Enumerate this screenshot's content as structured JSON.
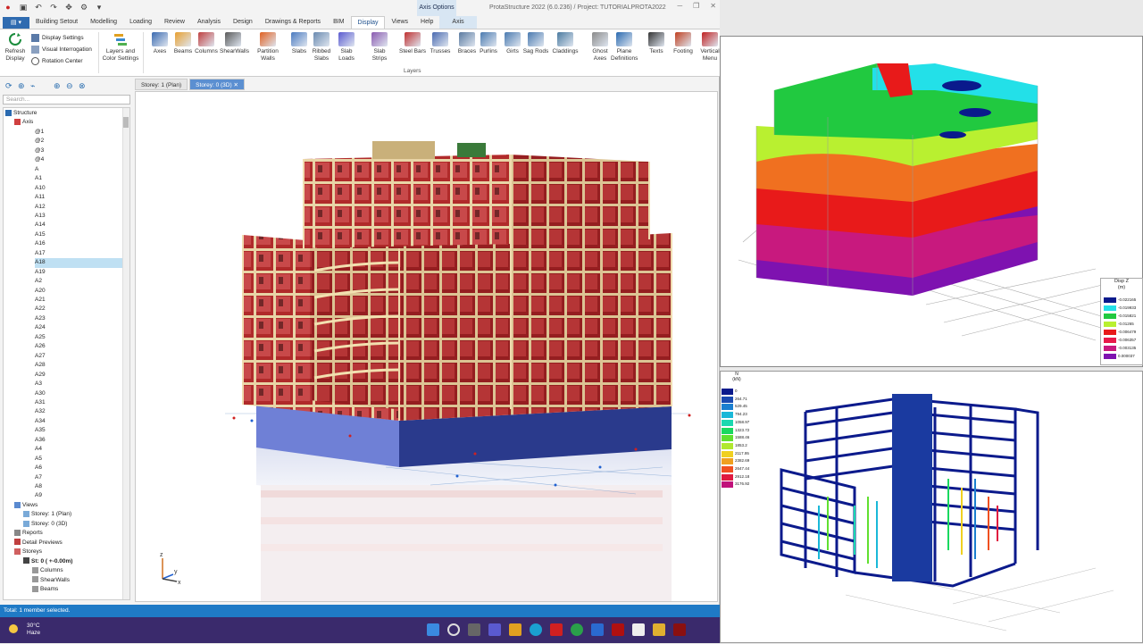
{
  "window": {
    "title": "ProtaStructure 2022 (6.0.236) / Project: TUTORIALPROTA2022",
    "context_tab_group": "Axis Options"
  },
  "tabs": [
    {
      "label": "Building Setout",
      "active": false
    },
    {
      "label": "Modelling",
      "active": false
    },
    {
      "label": "Loading",
      "active": false
    },
    {
      "label": "Review",
      "active": false
    },
    {
      "label": "Analysis",
      "active": false
    },
    {
      "label": "Design",
      "active": false
    },
    {
      "label": "Drawings & Reports",
      "active": false
    },
    {
      "label": "BIM",
      "active": false
    },
    {
      "label": "Display",
      "active": true
    },
    {
      "label": "Views",
      "active": false
    },
    {
      "label": "Help",
      "active": false
    },
    {
      "label": "Axis",
      "active": false
    }
  ],
  "ribbon": {
    "refresh": "Refresh Display",
    "display_settings": "Display Settings",
    "visual_interrogation": "Visual Interrogation",
    "rotation_center": "Rotation Center",
    "layers_colour": "Layers and Color Settings",
    "layer_buttons": [
      "Axes",
      "Beams",
      "Columns",
      "ShearWalls",
      "Partition Walls",
      "Slabs",
      "Ribbed Slabs",
      "Slab Loads",
      "Slab Strips",
      "Steel Bars",
      "Trusses",
      "Braces",
      "Purlins",
      "Girts",
      "Sag Rods",
      "Claddings",
      "Ghost Axes",
      "Plane Definitions",
      "Texts",
      "Footing",
      "Vertical Menu"
    ],
    "layers_group_label": "Layers"
  },
  "left_panel": {
    "search_placeholder": "Search...",
    "tree": {
      "structure": "Structure",
      "axis": "Axis",
      "axis_items": [
        "@1",
        "@2",
        "@3",
        "@4",
        "A",
        "A1",
        "A10",
        "A11",
        "A12",
        "A13",
        "A14",
        "A15",
        "A16",
        "A17",
        "A18",
        "A19",
        "A2",
        "A20",
        "A21",
        "A22",
        "A23",
        "A24",
        "A25",
        "A26",
        "A27",
        "A28",
        "A29",
        "A3",
        "A30",
        "A31",
        "A32",
        "A34",
        "A35",
        "A36",
        "A4",
        "A5",
        "A6",
        "A7",
        "A8",
        "A9"
      ],
      "selected_axis": "A18",
      "views": "Views",
      "view_items": [
        "Storey: 1 (Plan)",
        "Storey: 0 (3D)"
      ],
      "reports": "Reports",
      "detail_previews": "Detail Previews",
      "storeys": "Storeys",
      "storey0": "St: 0 ( +-0.00m)",
      "storey_items": [
        "Columns",
        "ShearWalls",
        "Beams"
      ]
    }
  },
  "view_tabs": [
    {
      "label": "Storey: 1 (Plan)",
      "active": false
    },
    {
      "label": "Storey: 0 (3D)",
      "active": true
    }
  ],
  "status_text": "Total: 1 member selected.",
  "taskbar": {
    "temperature": "30°C",
    "condition": "Haze"
  },
  "legend_disp": {
    "title": "Disp Z",
    "unit": "(m)",
    "values": [
      "-0.022165",
      "-0.019933",
      "-0.015821",
      "-0.01265",
      "-0.006479",
      "-0.006357",
      "-0.003135",
      "0.000037"
    ],
    "colors": [
      "#0a1a8c",
      "#23e0e8",
      "#21c940",
      "#b9f030",
      "#e81a1a",
      "#e81a4a",
      "#c8197e",
      "#7e12b0"
    ]
  },
  "legend_force": {
    "title": "N",
    "unit": "(kN)",
    "values": [
      "0",
      "264.71",
      "529.45",
      "794.23",
      "1058.97",
      "1323.72",
      "1588.46",
      "1853.2",
      "2117.95",
      "2382.69",
      "2647.44",
      "2912.18",
      "3176.92"
    ],
    "colors": [
      "#0b1a8c",
      "#1a4ab0",
      "#1a7fd0",
      "#1ab8d8",
      "#1ad8b0",
      "#1ad860",
      "#60e030",
      "#b0e830",
      "#f0d020",
      "#f0a020",
      "#f05020",
      "#e01a40",
      "#c0127a"
    ]
  }
}
